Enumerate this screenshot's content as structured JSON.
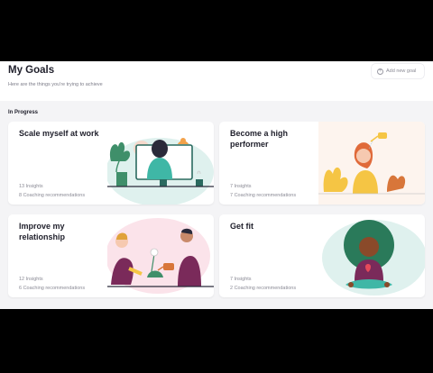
{
  "page": {
    "title": "My Goals",
    "subtitle": "Here are the things you're trying to achieve",
    "add_goal_label": "Add new goal",
    "section_label": "In Progress"
  },
  "goals": [
    {
      "title": "Scale myself at work",
      "insights": "13 Insights",
      "coaching": "8 Coaching recommendations",
      "illustration": "person-at-computer"
    },
    {
      "title": "Become a high performer",
      "insights": "7 Insights",
      "coaching": "7 Coaching recommendations",
      "illustration": "woman-watering-head"
    },
    {
      "title": "Improve my relationship",
      "insights": "12 Insights",
      "coaching": "6 Coaching recommendations",
      "illustration": "couple-gardening"
    },
    {
      "title": "Get fit",
      "insights": "7 Insights",
      "coaching": "2 Coaching recommendations",
      "illustration": "person-meditating"
    }
  ],
  "colors": {
    "background": "#f4f4f6",
    "card": "#ffffff",
    "text": "#1f1f2b",
    "muted": "#8a8a95",
    "accent_teal": "#3fb7a6",
    "accent_yellow": "#f5c544",
    "accent_pink": "#f3c4d3",
    "accent_plum": "#7a2a5a"
  }
}
